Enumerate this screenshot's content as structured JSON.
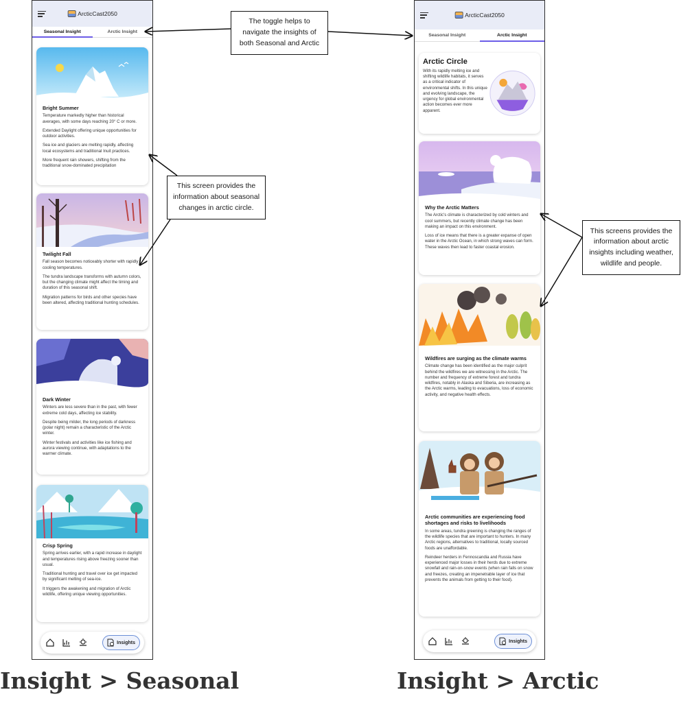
{
  "app": {
    "name": "ArcticCast2050"
  },
  "tabs": {
    "seasonal": "Seasonal Insight",
    "arctic": "Arctic Insight"
  },
  "nav": {
    "insights_label": "Insights"
  },
  "seasonal": {
    "cards": [
      {
        "title": "Bright Summer",
        "paragraphs": [
          "Temperature markedly higher than historical averages, with some days reaching 20° C or more.",
          "Extended Daylight offering unique opportunities for outdoor activities.",
          "Sea ice and glaciers are melting rapidly, affecting local ecosystems and traditional Inuit practices.",
          "More frequent rain showers, shifting from the traditional snow-dominated precipitation"
        ]
      },
      {
        "title": "Twilight Fall",
        "paragraphs": [
          "Fall season becomes noticeably shorter with rapidly cooling temperatures.",
          "The tundra landscape transforms with autumn colors, but the changing climate might affect the timing and duration of this seasonal shift.",
          "Migration patterns for birds and other species have been altered, affecting traditional hunting schedules."
        ]
      },
      {
        "title": "Dark Winter",
        "paragraphs": [
          "Winters are less severe than in the past, with fewer extreme cold days, affecting ice stability.",
          "Despite being milder, the long periods of darkness (polar night) remain a characteristic of the Arctic winter.",
          "Winter festivals and activities like ice fishing and aurora viewing continue, with adaptations to the warmer climate."
        ]
      },
      {
        "title": "Crisp Spring",
        "paragraphs": [
          "Spring arrives earlier, with a rapid increase in daylight and temperatures rising above freezing sooner than usual.",
          "Traditional hunting and travel over ice get impacted by significant melting of sea-ice.",
          "It triggers the awakening and migration of Arctic wildlife, offering unique viewing opportunities."
        ]
      }
    ]
  },
  "arctic": {
    "intro": {
      "title": "Arctic Circle",
      "text": "With its rapidly melting ice and shifting wildlife habitats, it serves as a critical indicator of environmental shifts. In this unique and evolving landscape, the urgency for global environmental action becomes ever more apparent."
    },
    "cards": [
      {
        "title": "Why the Arctic Matters",
        "paragraphs": [
          "The Arctic's climate is characterized by cold winters and cool summers, but recently climate change has been making an impact on this environment.",
          "Loss of ice means that there is a greater expanse of open water in the Arctic Ocean, in which strong waves can form. These waves then lead to faster coastal erosion."
        ]
      },
      {
        "title": "Wildfires are surging as the climate warms",
        "paragraphs": [
          "Climate change has been identified as the major culprit behind the wildfires we are witnessing in the Arctic. The number and frequency of extreme forest and tundra wildfires, notably in Alaska and Siberia, are increasing as the Arctic warms, leading to evacuations, loss of economic activity, and negative health effects."
        ]
      },
      {
        "title": "Arctic communities are experiencing food shortages and risks to livelihoods",
        "paragraphs": [
          "In some areas, tundra greening is changing the ranges of the wildlife species that are important to hunters. In many Arctic regions, alternatives to traditional, locally sourced foods are unaffordable.",
          "Reindeer herders in Fennoscandia and Russia have experienced major losses in their herds due to extreme snowfall and rain-on-snow events (when rain falls on snow and freezes, creating an impenetrable layer of ice that prevents the animals from getting to their food)."
        ]
      }
    ]
  },
  "annotations": {
    "toggle": "The toggle helps to navigate the insights of both Seasonal and Arctic",
    "seasonal_screen": "This screen provides the information about seasonal changes in arctic circle.",
    "arctic_screen": "This screens provides the information about arctic insights including weather, wildlife and people."
  },
  "captions": {
    "left": "Insight > Seasonal",
    "right": "Insight > Arctic"
  }
}
